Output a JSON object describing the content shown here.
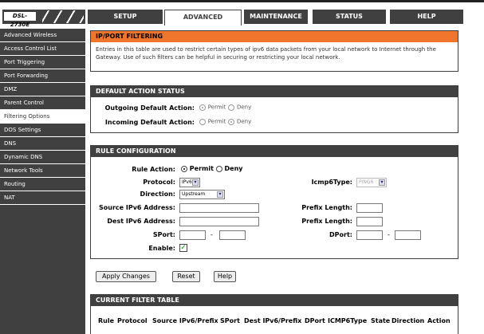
{
  "brand": {
    "model": "DSL-2730E"
  },
  "tabs": [
    "SETUP",
    "ADVANCED",
    "MAINTENANCE",
    "STATUS",
    "HELP"
  ],
  "sidebar": [
    "Advanced Wireless",
    "Access Control List",
    "Port Triggering",
    "Port Forwarding",
    "DMZ",
    "Parent Control",
    "Filtering Options",
    "DOS Settings",
    "DNS",
    "Dynamic DNS",
    "Network Tools",
    "Routing",
    "NAT"
  ],
  "intro": {
    "title": "IP/PORT FILTERING",
    "text": "Entries in this table are used to restrict certain types of ipv6 data packets from your local network to Internet through the Gateway. Use of such filters can be helpful in securing or restricting your local network."
  },
  "default_action": {
    "title": "DEFAULT ACTION STATUS",
    "outgoing_label": "Outgoing Default Action:",
    "incoming_label": "Incoming Default Action:",
    "permit": "Permit",
    "deny": "Deny",
    "outgoing_value": "Permit",
    "incoming_value": "Deny"
  },
  "rule": {
    "title": "RULE CONFIGURATION",
    "rule_action_label": "Rule Action:",
    "permit": "Permit",
    "deny": "Deny",
    "rule_action_value": "Permit",
    "protocol_label": "Protocol:",
    "protocol_value": "IPv6",
    "icmp_label": "Icmp6Type:",
    "icmp_value": "PING6",
    "direction_label": "Direction:",
    "direction_value": "Upstream",
    "src_label": "Source IPv6 Address:",
    "dst_label": "Dest IPv6 Address:",
    "src_prefix_label": "Prefix Length:",
    "dst_prefix_label": "Prefix Length:",
    "sport_label": "SPort:",
    "dport_label": "DPort:",
    "dash": "-",
    "enable_label": "Enable:",
    "enable_checked": true
  },
  "buttons": {
    "apply": "Apply Changes",
    "reset": "Reset",
    "help": "Help"
  },
  "filter_table": {
    "title": "CURRENT FILTER TABLE",
    "columns": [
      "Rule",
      "Protocol",
      "Source IPv6/Prefix",
      "SPort",
      "Dest IPv6/Prefix",
      "DPort",
      "ICMP6Type",
      "State",
      "Direction",
      "Action"
    ]
  }
}
